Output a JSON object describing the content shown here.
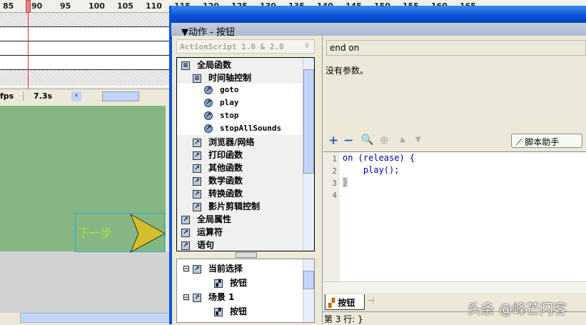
{
  "timeline": {
    "ticks": [
      "85",
      "90",
      "95",
      "100",
      "105",
      "110",
      "115",
      "120",
      "125",
      "130",
      "135",
      "140",
      "145",
      "150",
      "155",
      "160",
      "165"
    ],
    "fps_label": "fps",
    "time": "7.3s"
  },
  "stage": {
    "button_text": "下一步"
  },
  "panel": {
    "title": "▼动作 - 按钮",
    "version_select": "ActionScript 1.0 & 2.0",
    "tree": [
      {
        "label": "全局函数",
        "icon": "book-icon",
        "indent": 0
      },
      {
        "label": "时间轴控制",
        "icon": "book-icon",
        "indent": 1
      },
      {
        "label": "goto",
        "icon": "action-icon",
        "indent": 2
      },
      {
        "label": "play",
        "icon": "action-icon",
        "indent": 2
      },
      {
        "label": "stop",
        "icon": "action-icon",
        "indent": 2
      },
      {
        "label": "stopAllSounds",
        "icon": "action-icon",
        "indent": 2
      },
      {
        "label": "浏览器/网络",
        "icon": "folder-arrow-icon",
        "indent": 1
      },
      {
        "label": "打印函数",
        "icon": "folder-arrow-icon",
        "indent": 1
      },
      {
        "label": "其他函数",
        "icon": "folder-arrow-icon",
        "indent": 1
      },
      {
        "label": "数学函数",
        "icon": "folder-arrow-icon",
        "indent": 1
      },
      {
        "label": "转换函数",
        "icon": "folder-arrow-icon",
        "indent": 1
      },
      {
        "label": "影片剪辑控制",
        "icon": "folder-arrow-icon",
        "indent": 1
      },
      {
        "label": "全局属性",
        "icon": "folder-arrow-icon",
        "indent": 0
      },
      {
        "label": "运算符",
        "icon": "folder-arrow-icon",
        "indent": 0
      },
      {
        "label": "语句",
        "icon": "folder-arrow-icon",
        "indent": 0
      }
    ],
    "nav_tree": [
      {
        "label": "当前选择",
        "level": 0
      },
      {
        "label": "按钮",
        "level": 1
      },
      {
        "label": "场景 1",
        "level": 0
      },
      {
        "label": "按钮",
        "level": 1
      }
    ],
    "hint_field": "end on",
    "hint_desc": "没有参数。",
    "assist_label": "脚本助手",
    "code_lines": [
      "on (release) {",
      "    play();",
      "}",
      ""
    ],
    "line_numbers": [
      "1",
      "2",
      "3",
      "4"
    ],
    "tab_label": "按钮",
    "status": "第 3 行: }"
  },
  "watermark": "头条 @峰芒闪客"
}
